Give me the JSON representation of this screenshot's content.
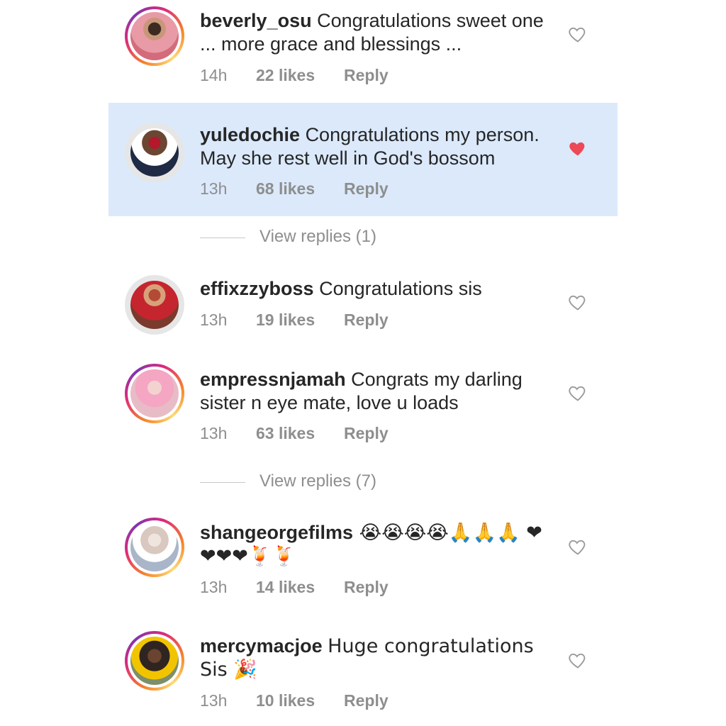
{
  "comments": [
    {
      "username": "beverly_osu",
      "text": "Congratulations sweet one ... more grace and blessings ...",
      "time": "14h",
      "likes": "22 likes",
      "reply": "Reply",
      "liked": false,
      "story_ring": true
    },
    {
      "username": "yuledochie",
      "text": "Congratulations my person. May she rest well in God's bossom",
      "time": "13h",
      "likes": "68 likes",
      "reply": "Reply",
      "liked": true,
      "story_ring": false
    },
    {
      "username": "effixzzyboss",
      "text": "Congratulations sis",
      "time": "13h",
      "likes": "19 likes",
      "reply": "Reply",
      "liked": false,
      "story_ring": false
    },
    {
      "username": "empressnjamah",
      "text": "Congrats my darling sister n eye mate, love u loads",
      "time": "13h",
      "likes": "63 likes",
      "reply": "Reply",
      "liked": false,
      "story_ring": true
    },
    {
      "username": "shangeorgefilms",
      "text": "😭😭😭😭🙏🙏🙏 ❤❤❤❤🍹🍹",
      "time": "13h",
      "likes": "14 likes",
      "reply": "Reply",
      "liked": false,
      "story_ring": true
    },
    {
      "username": "mercymacjoe",
      "text": "Huge congratulations Sis 🎉",
      "time": "13h",
      "likes": "10 likes",
      "reply": "Reply",
      "liked": false,
      "story_ring": true
    }
  ],
  "view_replies": [
    {
      "label": "View replies (1)"
    },
    {
      "label": "View replies (7)"
    }
  ],
  "colors": {
    "highlight": "#dbe9fb",
    "liked_heart": "#ed4956",
    "muted_text": "#8e8e8e"
  }
}
